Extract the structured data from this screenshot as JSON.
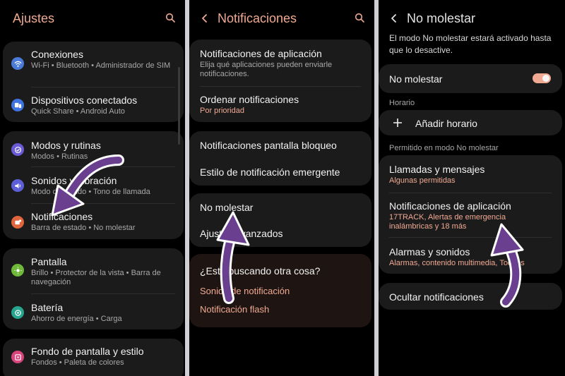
{
  "panel1": {
    "title": "Ajustes",
    "items": [
      {
        "title": "Conexiones",
        "sub": "Wi-Fi  •  Bluetooth  •  Administrador de SIM",
        "icon": "wifi-icon",
        "color": "#4a7bd8"
      },
      {
        "title": "Dispositivos conectados",
        "sub": "Quick Share  •  Android Auto",
        "icon": "devices-icon",
        "color": "#3f74e0"
      },
      {
        "title": "Modos y rutinas",
        "sub": "Modos  •  Rutinas",
        "icon": "check-circle-icon",
        "color": "#6b5bd6"
      },
      {
        "title": "Sonidos y vibración",
        "sub": "Modo de sonido  •  Tono de llamada",
        "icon": "volume-icon",
        "color": "#5c5fd8"
      },
      {
        "title": "Notificaciones",
        "sub": "Barra de estado  •  No molestar",
        "icon": "bell-icon",
        "color": "#e0643c"
      },
      {
        "title": "Pantalla",
        "sub": "Brillo  •  Protector de la vista  •  Barra de navegación",
        "icon": "sun-icon",
        "color": "#6fb83a"
      },
      {
        "title": "Batería",
        "sub": "Ahorro de energía  •  Carga",
        "icon": "battery-icon",
        "color": "#27a58f"
      },
      {
        "title": "Fondo de pantalla y estilo",
        "sub": "Fondos  •  Paleta de colores",
        "icon": "palette-icon",
        "color": "#d8457c"
      }
    ]
  },
  "panel2": {
    "title": "Notificaciones",
    "app_notifications": {
      "title": "Notificaciones de aplicación",
      "sub": "Elija qué aplicaciones pueden enviarle notificaciones."
    },
    "order": {
      "title": "Ordenar notificaciones",
      "sub": "Por prioridad"
    },
    "lockscreen": "Notificaciones pantalla bloqueo",
    "popup_style": "Estilo de notificación emergente",
    "dnd": "No molestar",
    "advanced": "Ajustes avanzados",
    "looking": {
      "title": "¿Está buscando otra cosa?",
      "link1": "Sonido de notificación",
      "link2": "Notificación flash"
    }
  },
  "panel3": {
    "title": "No molestar",
    "intro": "El modo No molestar estará activado hasta que lo desactive.",
    "dnd_toggle": {
      "label": "No molestar",
      "on": true
    },
    "schedule_header": "Horario",
    "add_schedule": "Añadir horario",
    "allowed_header": "Permitido en modo No molestar",
    "calls": {
      "title": "Llamadas y mensajes",
      "sub": "Algunas permitidas"
    },
    "app_notifications": {
      "title": "Notificaciones de aplicación",
      "sub": "17TRACK, Alertas de emergencia inalámbricas y 18 más"
    },
    "alarms": {
      "title": "Alarmas y sonidos",
      "sub": "Alarmas, contenido multimedia, Toques"
    },
    "hide": "Ocultar notificaciones"
  },
  "colors": {
    "accent": "#f0a993",
    "arrow": "#6b3f8f",
    "card": "#1b1b1b"
  }
}
